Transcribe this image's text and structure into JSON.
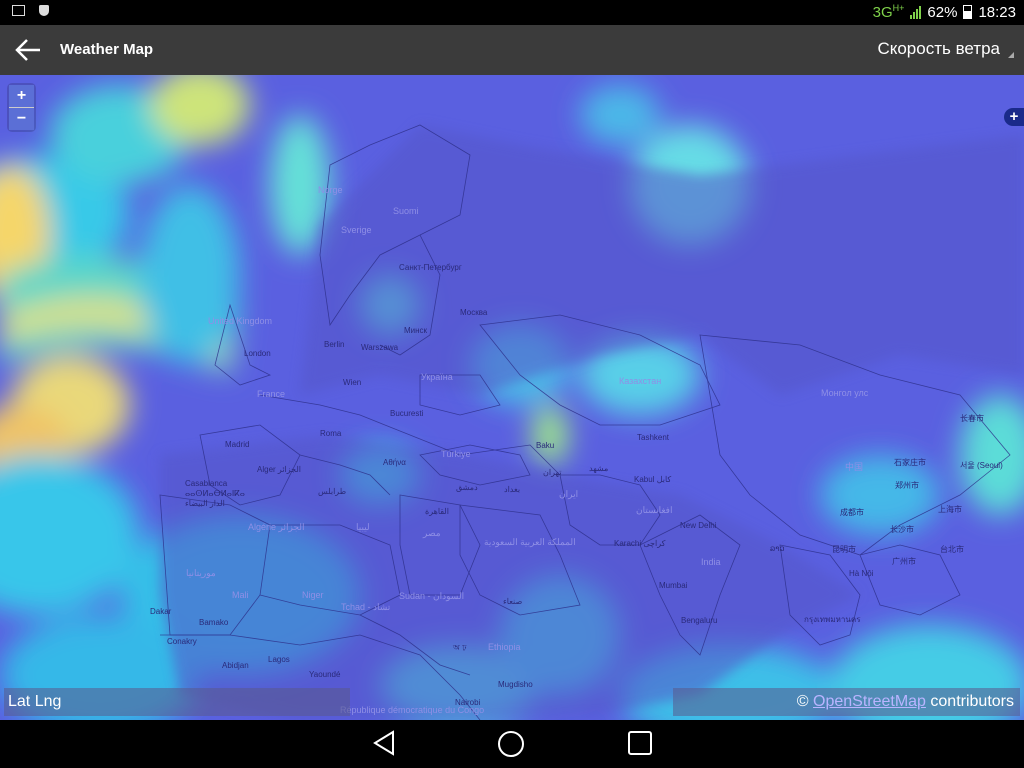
{
  "status": {
    "network": "3G",
    "network_sup": "H+",
    "battery": "62%",
    "time": "18:23"
  },
  "appbar": {
    "title": "Weather Map",
    "layer_select": "Скорость ветра"
  },
  "map": {
    "zoom_in": "+",
    "zoom_out": "−",
    "layer_button": "+",
    "latlng": "Lat Lng",
    "attribution_prefix": "©",
    "attribution_link": "OpenStreetMap",
    "attribution_suffix": "contributors",
    "countries": [
      "Norge",
      "Suomi",
      "Sverige",
      "United Kingdom",
      "France",
      "Україна",
      "Türkiye",
      "Казахстан",
      "Монгол улс",
      "中国",
      "India",
      "Algérie الجزائر",
      "Niger",
      "Tchad - تشاد",
      "Sudan - السودان",
      "Mali",
      "المملكة العربية السعودية",
      "مصر",
      "ليبيا",
      "ایران",
      "افغانستان",
      "Ethiopia",
      "République démocratique du Congo",
      "موريتانيا"
    ],
    "cities": [
      "Санкт-Петербург",
      "Москва",
      "Минск",
      "Berlin",
      "Warszawa",
      "London",
      "Wien",
      "Bucuresti",
      "Roma",
      "Madrid",
      "Alger الجزائر",
      "Αθήνα",
      "Casablanca ⴰⴰⵙⵍⴰⴱⵍⴰⵏⴽⴰ الدار البيضاء",
      "Baku",
      "Tashkent",
      "تهران",
      "Kabul کابل",
      "دمشق",
      "بغداد",
      "مشهد",
      "طرابلس",
      "القاهرة",
      "New Delhi",
      "Karachi کراچی",
      "Mumbai",
      "Bengaluru",
      "长春市",
      "石家庄市",
      "郑州市",
      "上海市",
      "成都市",
      "长沙市",
      "昆明市",
      "广州市",
      "台北市",
      "Hà Nội",
      "กรุงเทพมหานคร",
      "서울 (Seoul)",
      "ລາວ",
      "Dakar",
      "Bamako",
      "Conakry",
      "Abidjan",
      "Lagos",
      "Yaoundé",
      "Nairobi",
      "Mugdisho",
      "صنعاء",
      "অ ঢ়"
    ],
    "icons": [
      "zoom-in-icon",
      "zoom-out-icon",
      "layers-icon"
    ]
  },
  "nav": {
    "back_icon": "triangle-back-icon",
    "home_icon": "circle-home-icon",
    "recents_icon": "square-recents-icon"
  }
}
